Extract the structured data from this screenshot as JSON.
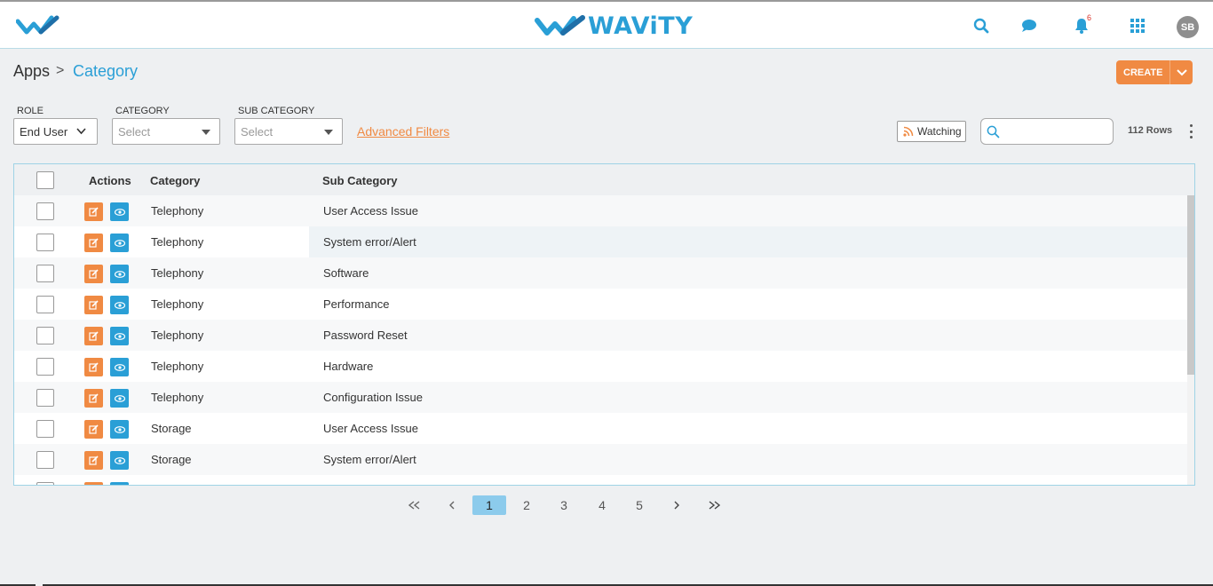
{
  "app": {
    "brand_name": "WAViTY",
    "brand_color": "#2a9fd6",
    "accent_color": "#f08a43",
    "logo_icon": "wavity-logo-icon"
  },
  "header": {
    "icons": [
      "search-icon",
      "chat-icon",
      "bell-icon",
      "apps-grid-icon"
    ],
    "notification_count": "6",
    "avatar_initials": "SB"
  },
  "breadcrumb": {
    "root": "Apps",
    "separator": ">",
    "current": "Category"
  },
  "create_button": {
    "label": "CREATE"
  },
  "filters": {
    "role": {
      "label": "ROLE",
      "value": "End User"
    },
    "category": {
      "label": "CATEGORY",
      "placeholder": "Select"
    },
    "sub_category": {
      "label": "SUB CATEGORY",
      "placeholder": "Select"
    },
    "advanced_link": "Advanced Filters"
  },
  "toolbar": {
    "watching_label": "Watching",
    "search_value": "",
    "rows_count": "112 Rows"
  },
  "table": {
    "headers": {
      "actions": "Actions",
      "category": "Category",
      "sub_category": "Sub Category"
    },
    "rows": [
      {
        "category": "Telephony",
        "sub_category": "User Access Issue"
      },
      {
        "category": "Telephony",
        "sub_category": "System error/Alert"
      },
      {
        "category": "Telephony",
        "sub_category": "Software"
      },
      {
        "category": "Telephony",
        "sub_category": "Performance"
      },
      {
        "category": "Telephony",
        "sub_category": "Password Reset"
      },
      {
        "category": "Telephony",
        "sub_category": "Hardware"
      },
      {
        "category": "Telephony",
        "sub_category": "Configuration Issue"
      },
      {
        "category": "Storage",
        "sub_category": "User Access Issue"
      },
      {
        "category": "Storage",
        "sub_category": "System error/Alert"
      }
    ]
  },
  "pagination": {
    "pages": [
      "1",
      "2",
      "3",
      "4",
      "5"
    ],
    "current": "1"
  }
}
